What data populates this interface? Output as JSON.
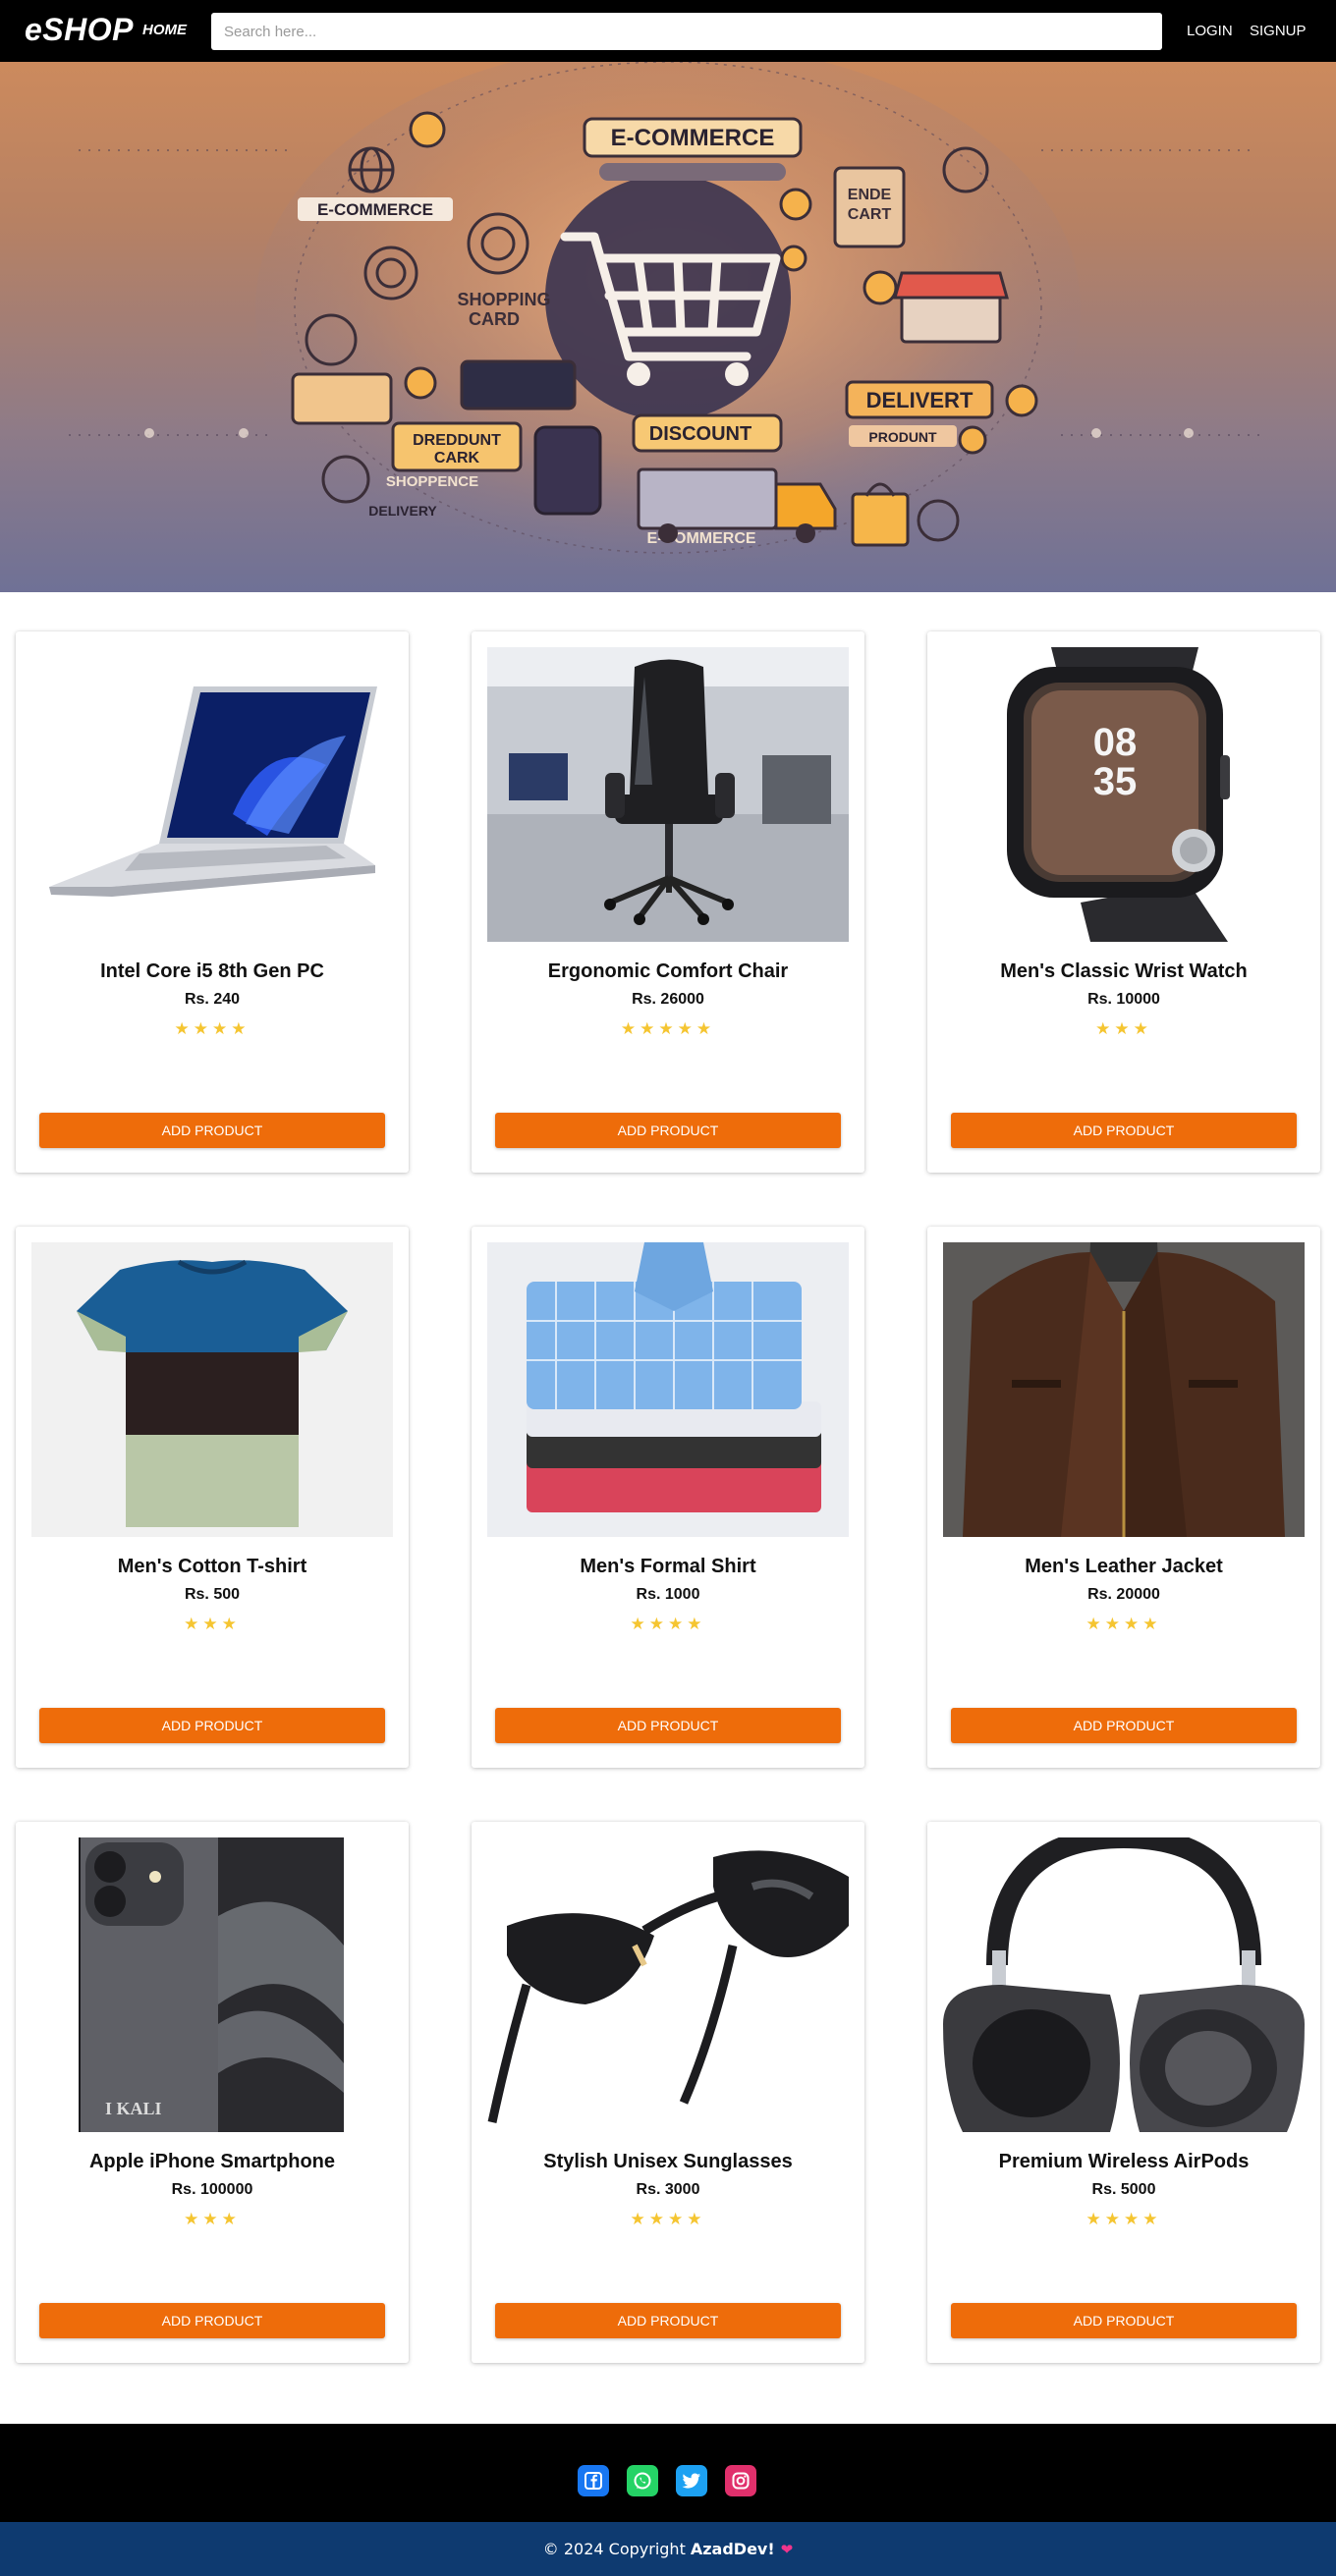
{
  "navbar": {
    "brand": "eSHOP",
    "home_label": "HOME",
    "search_placeholder": "Search here...",
    "login_label": "LOGIN",
    "signup_label": "SIGNUP"
  },
  "hero": {
    "banner_texts": [
      "E-COMMERCE",
      "E-COMMERCE",
      "SHOPPING CARD",
      "ENDE CART",
      "DELIVERT",
      "PRODUNT",
      "DISCOUNT",
      "DREDDUNT CARK",
      "SHOPPENCE",
      "DELIVERY",
      "E-COMMERCE"
    ]
  },
  "products": [
    {
      "name": "Intel Core i5 8th Gen PC",
      "price": "Rs. 240",
      "rating": 4,
      "button": "ADD PRODUCT",
      "icon": "laptop-image"
    },
    {
      "name": "Ergonomic Comfort Chair",
      "price": "Rs. 26000",
      "rating": 5,
      "button": "ADD PRODUCT",
      "icon": "chair-image"
    },
    {
      "name": "Men's Classic Wrist Watch",
      "price": "Rs. 10000",
      "rating": 3,
      "button": "ADD PRODUCT",
      "icon": "watch-image"
    },
    {
      "name": "Men's Cotton T-shirt",
      "price": "Rs. 500",
      "rating": 3,
      "button": "ADD PRODUCT",
      "icon": "tshirt-image"
    },
    {
      "name": "Men's Formal Shirt",
      "price": "Rs. 1000",
      "rating": 4,
      "button": "ADD PRODUCT",
      "icon": "shirts-image"
    },
    {
      "name": "Men's Leather Jacket",
      "price": "Rs. 20000",
      "rating": 4,
      "button": "ADD PRODUCT",
      "icon": "jacket-image"
    },
    {
      "name": "Apple iPhone Smartphone",
      "price": "Rs. 100000",
      "rating": 3,
      "button": "ADD PRODUCT",
      "icon": "phone-image",
      "image_text": "I KALI"
    },
    {
      "name": "Stylish Unisex Sunglasses",
      "price": "Rs. 3000",
      "rating": 4,
      "button": "ADD PRODUCT",
      "icon": "sunglasses-image"
    },
    {
      "name": "Premium Wireless AirPods",
      "price": "Rs. 5000",
      "rating": 4,
      "button": "ADD PRODUCT",
      "icon": "headphones-image"
    }
  ],
  "footer": {
    "social": [
      {
        "name": "facebook-icon",
        "color": "#1877f2"
      },
      {
        "name": "whatsapp-icon",
        "color": "#25d366"
      },
      {
        "name": "twitter-icon",
        "color": "#1da1f2"
      },
      {
        "name": "instagram-icon",
        "color": "#e1306c"
      }
    ],
    "copyright_prefix": "© 2024 Copyright",
    "copyright_author": "AzadDev!",
    "heart_icon": "heart-icon"
  },
  "colors": {
    "accent_button": "#ee6c0a",
    "star": "#f5c531",
    "navbar_bg": "#000000",
    "copyright_bg": "#0e3a70"
  }
}
